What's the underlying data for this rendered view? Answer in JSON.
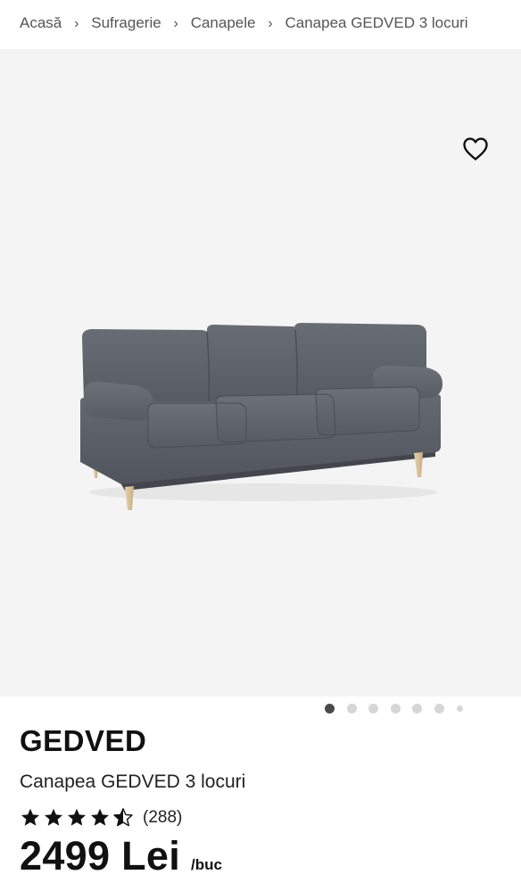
{
  "breadcrumb": {
    "items": [
      "Acasă",
      "Sufragerie",
      "Canapele",
      "Canapea GEDVED 3 locuri"
    ],
    "separator_icon": "chevron-right-icon"
  },
  "gallery": {
    "favorite_icon": "heart-outline-icon",
    "image_subject": "grey three-seat sofa with wooden legs",
    "dots_total": 7,
    "active_dot": 1
  },
  "product": {
    "brand": "GEDVED",
    "name": "Canapea GEDVED 3 locuri",
    "rating_value": 4.5,
    "rating_max": 5,
    "rating_count": "(288)",
    "price": "2499 Lei",
    "unit": "/buc"
  },
  "colors": {
    "gallery_bg": "#f4f4f4",
    "sofa_fabric": "#5f636c",
    "active_dot": "#4a4a4a",
    "inactive_dot": "#d6d6d6"
  }
}
